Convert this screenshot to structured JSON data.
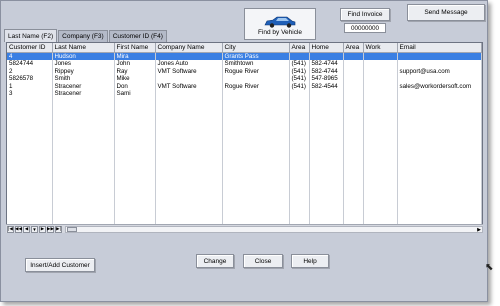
{
  "tabs": [
    {
      "label": "Last Name (F2)",
      "active": true
    },
    {
      "label": "Company (F3)",
      "active": false
    },
    {
      "label": "Customer ID (F4)",
      "active": false
    }
  ],
  "toolbar": {
    "find_by_vehicle": "Find by Vehicle",
    "find_invoice": "Find Invoice",
    "invoice_value": "00000000",
    "send_message": "Send Message"
  },
  "columns": [
    "Customer ID",
    "Last Name",
    "First Name",
    "Company Name",
    "City",
    "Area",
    "Home",
    "Area",
    "Work",
    "Email"
  ],
  "rows": [
    {
      "id": "4",
      "last": "Hudson",
      "first": "Mira",
      "company": "",
      "city": "Grants Pass",
      "area": "",
      "home": "",
      "area2": "",
      "work": "",
      "email": "",
      "selected": true
    },
    {
      "id": "5824744",
      "last": "Jones",
      "first": "John",
      "company": "Jones Auto",
      "city": "Smithtown",
      "area": "(541)",
      "home": "582-4744",
      "area2": "",
      "work": "",
      "email": "",
      "selected": false
    },
    {
      "id": "2",
      "last": "Rippey",
      "first": "Ray",
      "company": "VMT Software",
      "city": "Rogue River",
      "area": "(541)",
      "home": "582-4744",
      "area2": "",
      "work": "",
      "email": "support@usa.com",
      "selected": false
    },
    {
      "id": "5826578",
      "last": "Smith",
      "first": "Mike",
      "company": "",
      "city": "",
      "area": "(541)",
      "home": "547-8965",
      "area2": "",
      "work": "",
      "email": "",
      "selected": false
    },
    {
      "id": "1",
      "last": "Stracener",
      "first": "Don",
      "company": "VMT Software",
      "city": "Rogue River",
      "area": "(541)",
      "home": "582-4544",
      "area2": "",
      "work": "",
      "email": "sales@workordersoft.com",
      "selected": false
    },
    {
      "id": "3",
      "last": "Stracener",
      "first": "Sami",
      "company": "",
      "city": "",
      "area": "",
      "home": "",
      "area2": "",
      "work": "",
      "email": "",
      "selected": false
    }
  ],
  "navigator": {
    "buttons": [
      "|◀",
      "◀◀",
      "◀",
      "▼",
      "▶",
      "▶▶",
      "▶|"
    ]
  },
  "footer": {
    "insert_label": "Insert/Add Customer",
    "change_label": "Change",
    "close_label": "Close",
    "help_label": "Help"
  }
}
